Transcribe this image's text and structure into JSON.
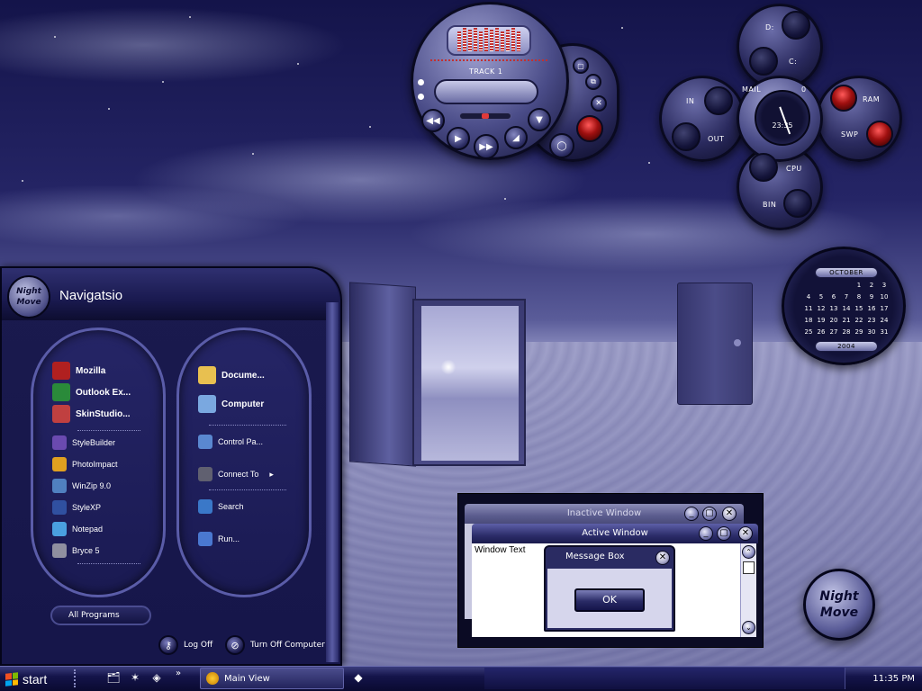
{
  "media_player": {
    "track_label": "TRACK 1"
  },
  "system_monitor": {
    "labels": {
      "d": "D:",
      "c": "C:",
      "mail": "MAIL",
      "mail_count": "0",
      "in": "IN",
      "out": "OUT",
      "ram": "RAM",
      "swp": "SWP",
      "cpu": "CPU",
      "bin": "BIN"
    },
    "clock_time": "23:35"
  },
  "calendar": {
    "month": "OCTOBER",
    "year": "2004",
    "days": [
      "1",
      "2",
      "3",
      "4",
      "5",
      "6",
      "7",
      "8",
      "9",
      "10",
      "11",
      "12",
      "13",
      "14",
      "15",
      "16",
      "17",
      "18",
      "19",
      "20",
      "21",
      "22",
      "23",
      "24",
      "25",
      "26",
      "27",
      "28",
      "29",
      "30",
      "31"
    ]
  },
  "start_menu": {
    "avatar_text_1": "Night",
    "avatar_text_2": "Move",
    "user_name": "Navigatsio",
    "pinned": [
      {
        "label": "Mozilla",
        "icon": "mozilla-icon"
      },
      {
        "label": "Outlook Ex...",
        "icon": "outlook-express-icon"
      },
      {
        "label": "SkinStudio...",
        "icon": "skinstudio-icon"
      }
    ],
    "recent": [
      {
        "label": "StyleBuilder",
        "icon": "stylebuilder-icon"
      },
      {
        "label": "PhotoImpact",
        "icon": "photoimpact-icon"
      },
      {
        "label": "WinZip 9.0",
        "icon": "winzip-icon"
      },
      {
        "label": "StyleXP",
        "icon": "stylexp-icon"
      },
      {
        "label": "Notepad",
        "icon": "notepad-icon"
      },
      {
        "label": "Bryce 5",
        "icon": "bryce-icon"
      }
    ],
    "places_bold": [
      {
        "label": "Docume...",
        "icon": "documents-folder-icon"
      },
      {
        "label": "Computer",
        "icon": "computer-icon"
      }
    ],
    "places": [
      {
        "label": "Control Pa...",
        "icon": "control-panel-icon"
      },
      {
        "label": "Connect To",
        "icon": "connect-to-icon"
      },
      {
        "label": "Search",
        "icon": "search-icon"
      },
      {
        "label": "Run...",
        "icon": "run-icon"
      }
    ],
    "all_programs": "All Programs",
    "log_off": "Log Off",
    "turn_off": "Turn Off Computer"
  },
  "windows": {
    "inactive_title": "Inactive Window",
    "active_title": "Active Window",
    "window_text": "Window Text",
    "message_box_title": "Message Box",
    "ok_label": "OK"
  },
  "logo": {
    "line1": "Night",
    "line2": "Move"
  },
  "taskbar": {
    "start_label": "start",
    "task_label": "Main View",
    "clock": "11:35 PM"
  }
}
